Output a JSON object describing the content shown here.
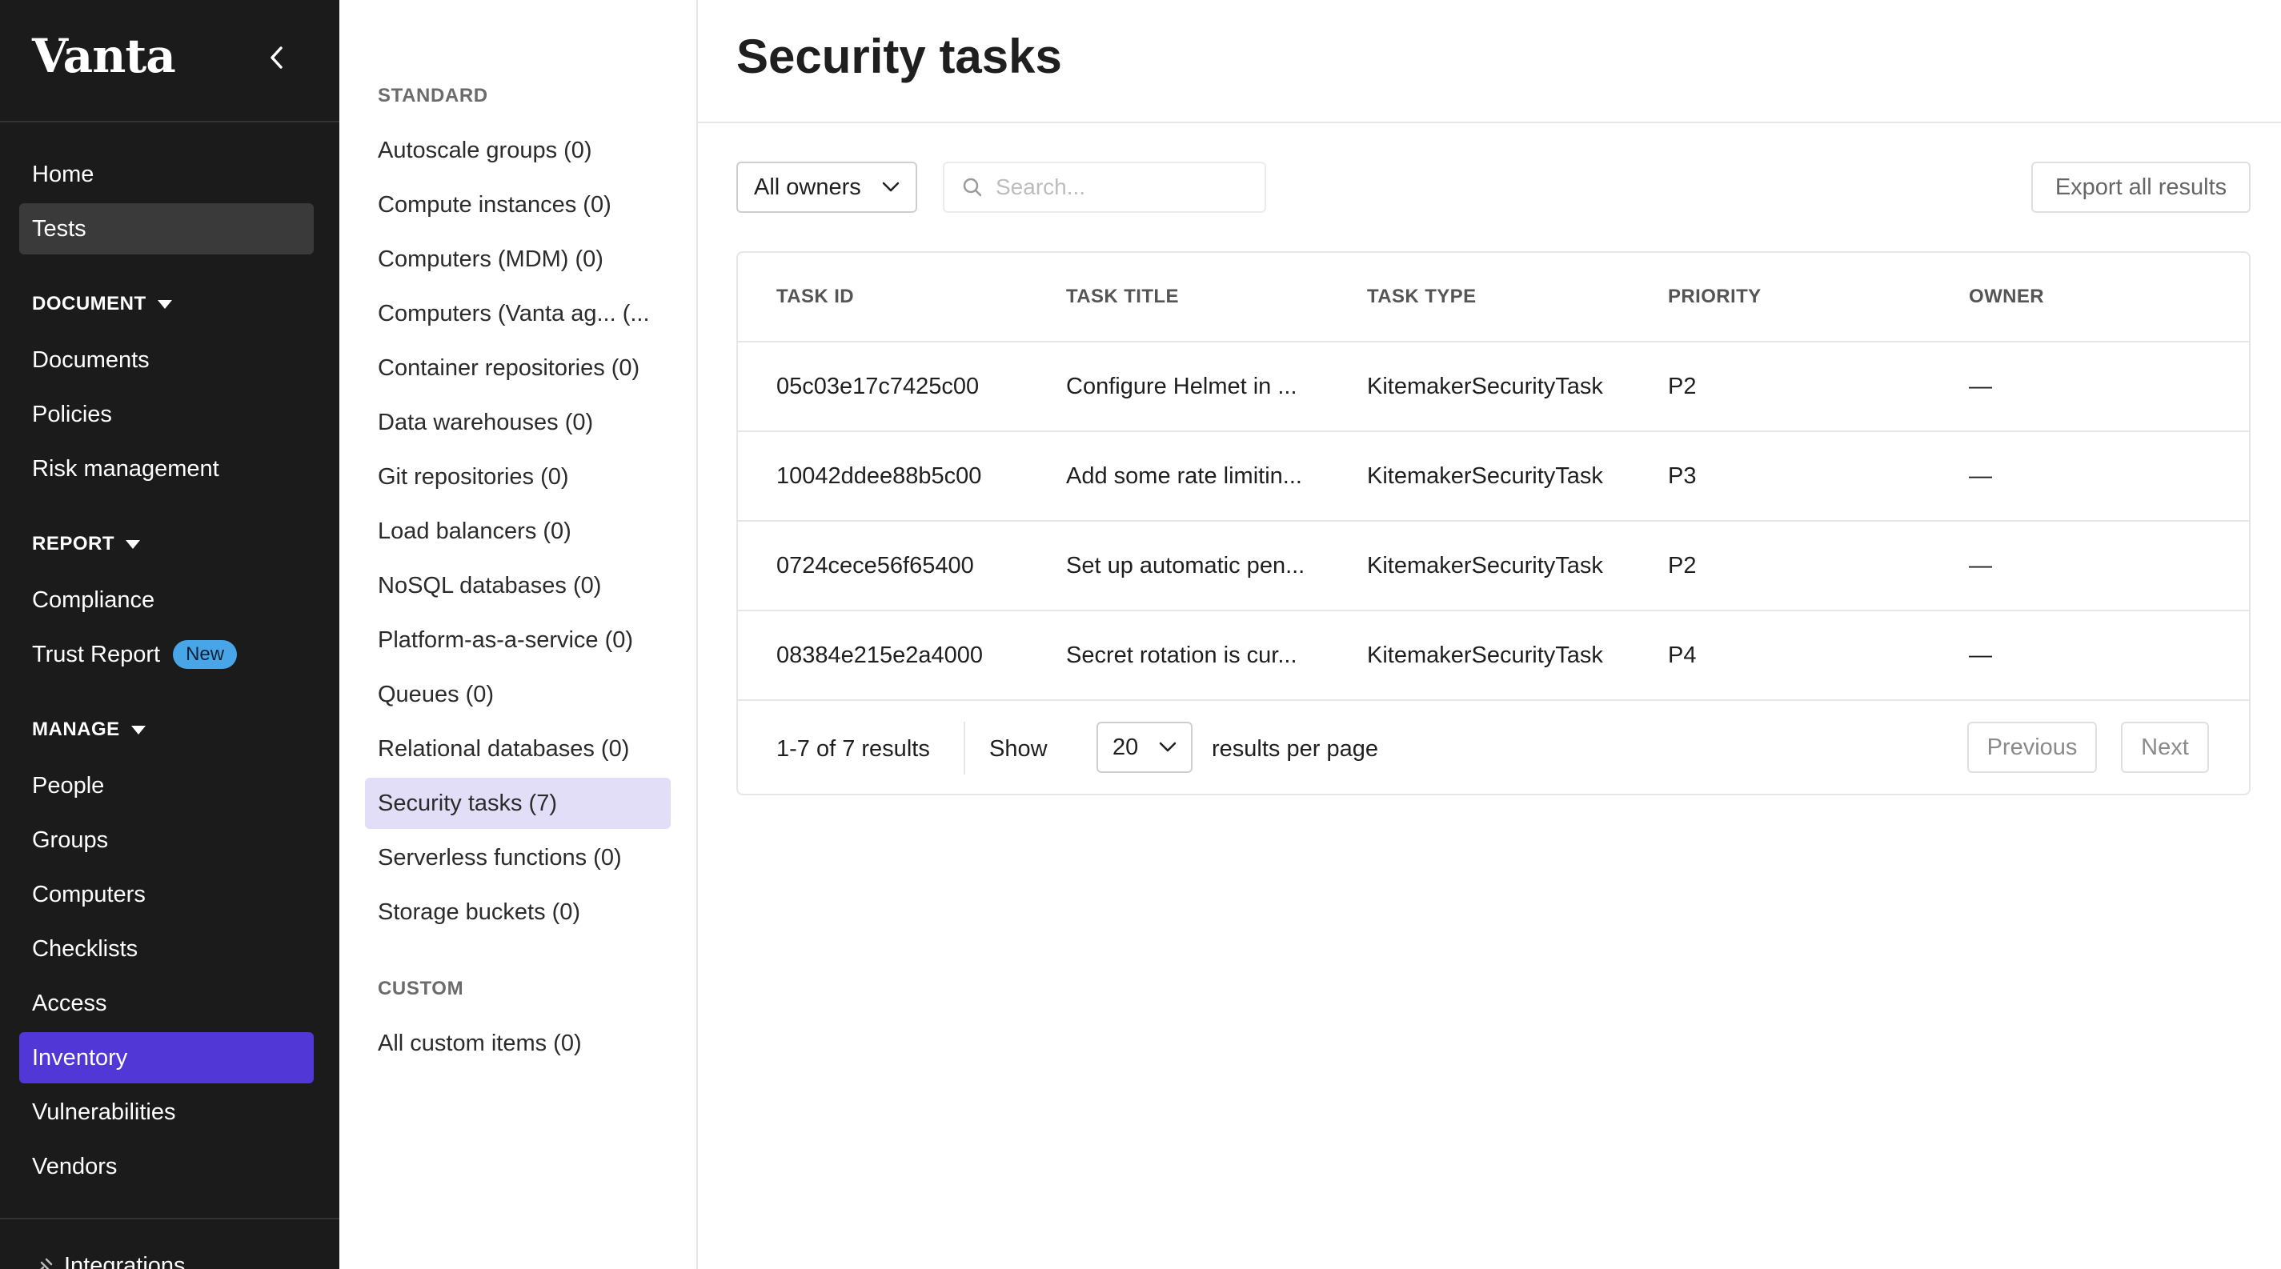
{
  "brand": {
    "logo_text": "Vanta",
    "accent_color": "#5137d6",
    "selected_category_bg": "#e3def8",
    "new_badge_color": "#48a6e8"
  },
  "sidebar": {
    "top_items": [
      {
        "label": "Home"
      },
      {
        "label": "Tests"
      }
    ],
    "sections": [
      {
        "title": "DOCUMENT",
        "items": [
          {
            "label": "Documents"
          },
          {
            "label": "Policies"
          },
          {
            "label": "Risk management"
          }
        ]
      },
      {
        "title": "REPORT",
        "items": [
          {
            "label": "Compliance"
          },
          {
            "label": "Trust Report",
            "badge": "New"
          }
        ]
      },
      {
        "title": "MANAGE",
        "items": [
          {
            "label": "People"
          },
          {
            "label": "Groups"
          },
          {
            "label": "Computers"
          },
          {
            "label": "Checklists"
          },
          {
            "label": "Access"
          },
          {
            "label": "Inventory"
          },
          {
            "label": "Vulnerabilities"
          },
          {
            "label": "Vendors"
          }
        ]
      }
    ],
    "bottom_item": {
      "label": "Integrations",
      "icon": "integrations-icon"
    }
  },
  "categories": {
    "standard_heading": "STANDARD",
    "standard_items": [
      "Autoscale groups (0)",
      "Compute instances (0)",
      "Computers (MDM) (0)",
      "Computers (Vanta ag... (...",
      "Container repositories (0)",
      "Data warehouses (0)",
      "Git repositories (0)",
      "Load balancers (0)",
      "NoSQL databases (0)",
      "Platform-as-a-service (0)",
      "Queues (0)",
      "Relational databases (0)",
      "Security tasks (7)",
      "Serverless functions (0)",
      "Storage buckets (0)"
    ],
    "custom_heading": "CUSTOM",
    "custom_items": [
      "All custom items (0)"
    ]
  },
  "main": {
    "title": "Security tasks",
    "owners_filter": "All owners",
    "search_placeholder": "Search...",
    "export_label": "Export all results",
    "table": {
      "columns": [
        "TASK ID",
        "TASK TITLE",
        "TASK TYPE",
        "PRIORITY",
        "OWNER"
      ],
      "rows": [
        [
          "05c03e17c7425c00",
          "Configure Helmet in ...",
          "KitemakerSecurityTask",
          "P2",
          "—"
        ],
        [
          "10042ddee88b5c00",
          "Add some rate limitin...",
          "KitemakerSecurityTask",
          "P3",
          "—"
        ],
        [
          "0724cece56f65400",
          "Set up automatic pen...",
          "KitemakerSecurityTask",
          "P2",
          "—"
        ],
        [
          "08384e215e2a4000",
          "Secret rotation is cur...",
          "KitemakerSecurityTask",
          "P4",
          "—"
        ]
      ]
    },
    "footer": {
      "results": "1-7 of 7 results",
      "show_label": "Show",
      "per_page_value": "20",
      "per_page_label": "results per page",
      "prev_label": "Previous",
      "next_label": "Next"
    }
  }
}
